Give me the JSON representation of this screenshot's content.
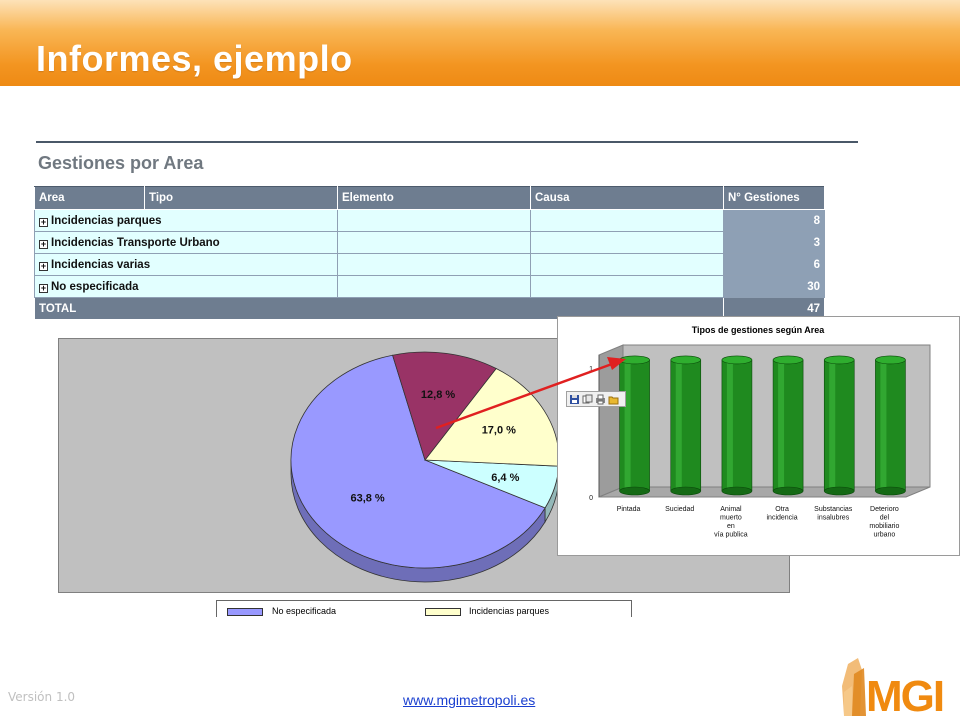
{
  "slide": {
    "title": "Informes, ejemplo",
    "version": "Versión 1.0",
    "website": "www.mgimetropoli.es",
    "logo_text": "MGI"
  },
  "report": {
    "title": "Gestiones por Area",
    "columns": [
      "Area",
      "Tipo",
      "Elemento",
      "Causa",
      "N° Gestiones"
    ],
    "rows": [
      {
        "expand": "+",
        "area": "Incidencias parques",
        "count": "8"
      },
      {
        "expand": "+",
        "area": "Incidencias Transporte Urbano",
        "count": "3"
      },
      {
        "expand": "+",
        "area": "Incidencias varias",
        "count": "6"
      },
      {
        "expand": "+",
        "area": "No especificada",
        "count": "30"
      }
    ],
    "total": {
      "label": "TOTAL",
      "count": "47"
    }
  },
  "pie_legend": {
    "items": [
      {
        "label": "No especificada",
        "color": "#9999ff"
      },
      {
        "label": "Incidencias parques",
        "color": "#ffffcc"
      }
    ]
  },
  "toolbar": {
    "icons": [
      "save-icon",
      "copy-icon",
      "print-icon",
      "folder-icon"
    ]
  },
  "colors": {
    "header_orange": "#f39521",
    "table_header": "#6e7d90",
    "table_cell": "#e2ffff",
    "bar_green": "#1f8a1f",
    "arrow_red": "#e02020"
  },
  "chart_data": [
    {
      "type": "pie",
      "title": "",
      "slices": [
        {
          "label": "63,8 %",
          "value": 63.8,
          "color": "#9999ff"
        },
        {
          "label": "6,4 %",
          "value": 6.4,
          "color": "#ccffff"
        },
        {
          "label": "17,0 %",
          "value": 17.0,
          "color": "#ffffcc"
        },
        {
          "label": "12,8 %",
          "value": 12.8,
          "color": "#993366"
        }
      ],
      "legend": "bottom"
    },
    {
      "type": "bar",
      "title": "Tipos de gestiones según Area",
      "categories": [
        [
          "Pintada"
        ],
        [
          "Suciedad"
        ],
        [
          "Animal",
          "muerto",
          "en",
          "vía publica"
        ],
        [
          "Otra",
          "incidencia"
        ],
        [
          "Substancias",
          "insalubres"
        ],
        [
          "Deterioro",
          "del",
          "mobiliario",
          "urbano"
        ]
      ],
      "values": [
        1,
        1,
        1,
        1,
        1,
        1
      ],
      "y_tick_labels": [
        "0",
        "1"
      ],
      "ylim": [
        0,
        1.1
      ],
      "grid": false
    }
  ]
}
